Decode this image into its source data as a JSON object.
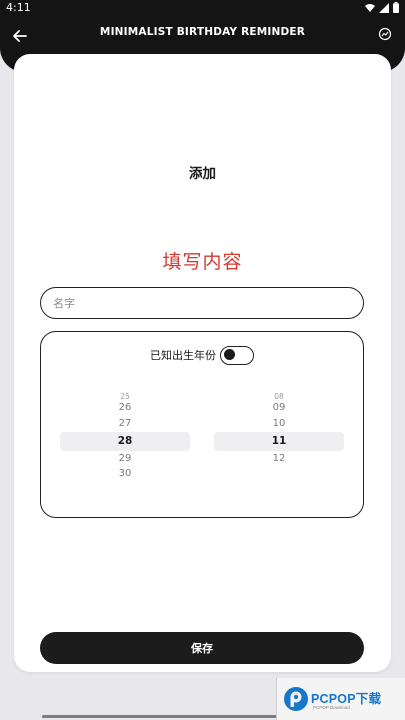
{
  "status_bar": {
    "time": "4:11"
  },
  "app_bar": {
    "title": "MINIMALIST BIRTHDAY REMINDER"
  },
  "card": {
    "heading": "添加",
    "section_title": "填写内容",
    "name_input": {
      "placeholder": "名字",
      "value": ""
    },
    "date_picker": {
      "year_toggle_label": "已知出生年份",
      "year_toggle_on": false,
      "day_wheel": {
        "items": [
          "25",
          "26",
          "27",
          "28",
          "29",
          "30"
        ],
        "selected": "28"
      },
      "month_wheel": {
        "items": [
          "08",
          "09",
          "10",
          "11",
          "12"
        ],
        "selected": "11"
      }
    },
    "save_label": "保存"
  },
  "watermark": {
    "text": "PCPOP下载",
    "subtext": "PCPOP Download"
  },
  "colors": {
    "accent_red": "#d23a30",
    "dark": "#141414",
    "background": "#e8e8ec"
  }
}
